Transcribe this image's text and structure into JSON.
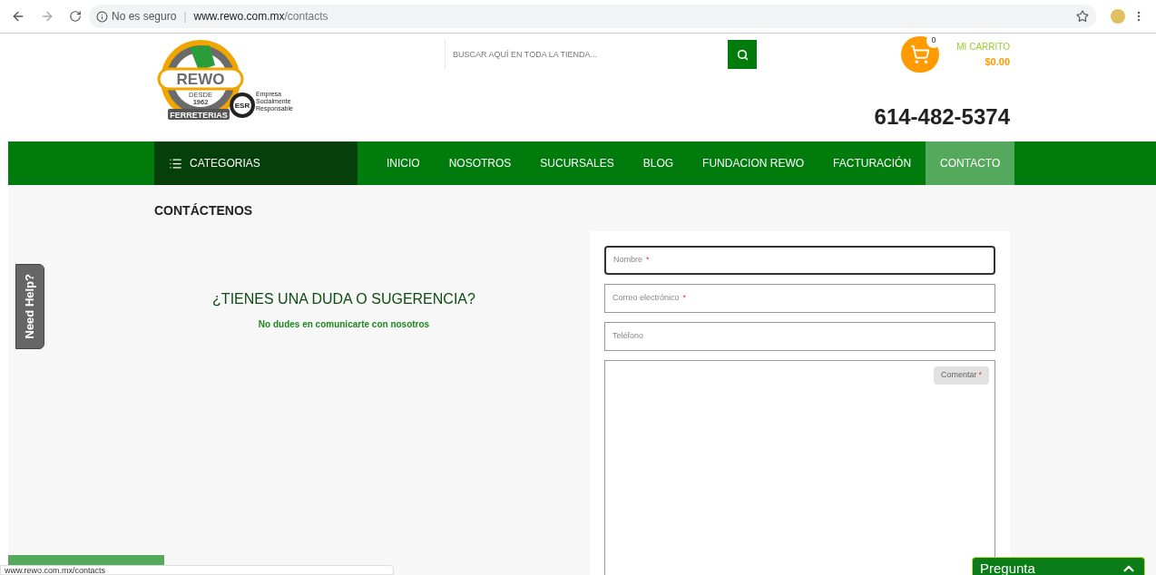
{
  "browser": {
    "security": "No es seguro",
    "separator": "|",
    "url_host": "www.rewo.com.mx",
    "url_path": "/contacts"
  },
  "logo": {
    "name": "REWO",
    "tagline": "FERRETERIAS",
    "since": "DESDE",
    "year": "1962",
    "badge": "ESR",
    "badge_text": "Empresa Socialmente Responsable"
  },
  "search": {
    "placeholder": "BUSCAR AQUÍ EN TODA LA TIENDA..."
  },
  "cart": {
    "count": "0",
    "label": "MI CARRITO",
    "total": "$0.00"
  },
  "phone": "614-482-5374",
  "nav": {
    "categories": "CATEGORIAS",
    "items": [
      {
        "label": "INICIO",
        "selected": false
      },
      {
        "label": "NOSOTROS",
        "selected": false
      },
      {
        "label": "SUCURSALES",
        "selected": false
      },
      {
        "label": "BLOG",
        "selected": false
      },
      {
        "label": "FUNDACION REWO",
        "selected": false
      },
      {
        "label": "FACTURACIÓN",
        "selected": false
      },
      {
        "label": "CONTACTO",
        "selected": true
      }
    ]
  },
  "page_title": "CONTÁCTENOS",
  "need_help": "Need Help?",
  "intro": {
    "heading": "¿TIENES UNA DUDA O SUGERENCIA?",
    "subheading": "No dudes en comunicarte con nosotros"
  },
  "form": {
    "required_mark": "*",
    "fields": [
      {
        "placeholder": "Nombre",
        "required": true,
        "focused": true
      },
      {
        "placeholder": "Correo electrónico",
        "required": true,
        "focused": false
      },
      {
        "placeholder": "Teléfono",
        "required": false,
        "focused": false
      }
    ],
    "comment": {
      "placeholder": "Comentar",
      "required": true
    }
  },
  "status_url": "www.rewo.com.mx/contacts",
  "chat": {
    "label": "Pregunta"
  }
}
